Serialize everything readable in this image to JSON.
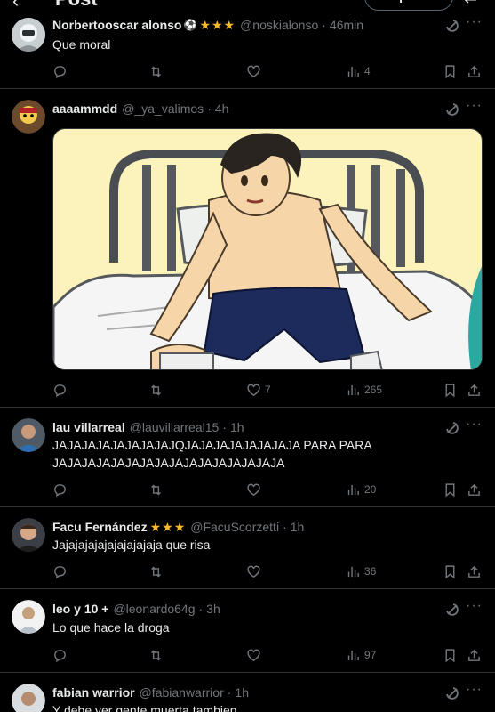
{
  "topbar": {
    "back": "‹",
    "title": "Post",
    "reply_button": "Responder"
  },
  "tweets": [
    {
      "name": "Norbertooscar alonso",
      "handle": "@noskialonso",
      "time": "46min",
      "text": "Que moral",
      "replies": "",
      "retweets": "",
      "likes": "",
      "views": "4",
      "badges": "★★★",
      "ball": "⚽"
    },
    {
      "name": "aaaammdd",
      "handle": "@_ya_valimos",
      "time": "4h",
      "text": "",
      "replies": "",
      "retweets": "",
      "likes": "7",
      "views": "265"
    },
    {
      "name": "lau villarreal",
      "handle": "@lauvillarreal15",
      "time": "1h",
      "text": "JAJAJAJAJAJAJAJAJQJAJAJAJAJAJAJAJA PARA PARA JAJAJAJAJAJAJAJAJAJAJAJAJAJAJAJA",
      "replies": "",
      "retweets": "",
      "likes": "",
      "views": "20"
    },
    {
      "name": "Facu Fernández",
      "handle": "@FacuScorzetti",
      "time": "1h",
      "text": "Jajajajajajajajajajaja que risa",
      "replies": "",
      "retweets": "",
      "likes": "",
      "views": "36",
      "badges": "★★★"
    },
    {
      "name": "leo y 10 +",
      "handle": "@leonardo64g",
      "time": "3h",
      "text": "Lo que hace la droga",
      "replies": "",
      "retweets": "",
      "likes": "",
      "views": "97"
    },
    {
      "name": "fabian warrior",
      "handle": "@fabianwarrior",
      "time": "1h",
      "text": "Y debe ver gente muerta tambien"
    }
  ],
  "colors": {
    "background": "#000000",
    "text": "#e7e9ea",
    "muted": "#71767b",
    "divider": "#2f3336",
    "star": "#f7b928"
  },
  "icons": [
    "back-icon",
    "settings-icon",
    "grok-icon",
    "more-icon",
    "reply-icon",
    "retweet-icon",
    "like-icon",
    "views-icon",
    "bookmark-icon",
    "share-icon"
  ]
}
